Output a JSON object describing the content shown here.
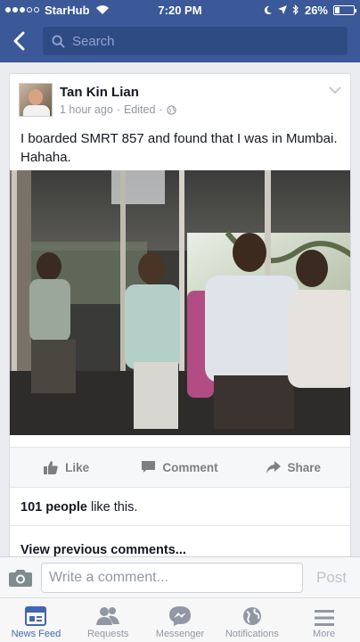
{
  "status_bar": {
    "carrier": "StarHub",
    "time": "7:20 PM",
    "battery": "26%",
    "battery_level": 0.26
  },
  "nav": {
    "search_placeholder": "Search"
  },
  "post": {
    "author": "Tan Kin Lian",
    "time": "1 hour ago",
    "edited": "Edited",
    "text": "I boarded SMRT 857 and found that I was in Mumbai. Hahaha.",
    "actions": {
      "like": "Like",
      "comment": "Comment",
      "share": "Share"
    },
    "likes_count": "101 people",
    "likes_suffix": "like this.",
    "view_previous": "View previous comments..."
  },
  "comment_bar": {
    "placeholder": "Write a comment...",
    "post_label": "Post"
  },
  "tabs": [
    {
      "label": "News Feed",
      "icon": "news-feed-icon",
      "active": true
    },
    {
      "label": "Requests",
      "icon": "friends-icon"
    },
    {
      "label": "Messenger",
      "icon": "messenger-icon"
    },
    {
      "label": "Notifications",
      "icon": "globe-icon"
    },
    {
      "label": "More",
      "icon": "menu-icon"
    }
  ],
  "colors": {
    "brand": "#3b5998",
    "active_tab": "#4267b2"
  }
}
